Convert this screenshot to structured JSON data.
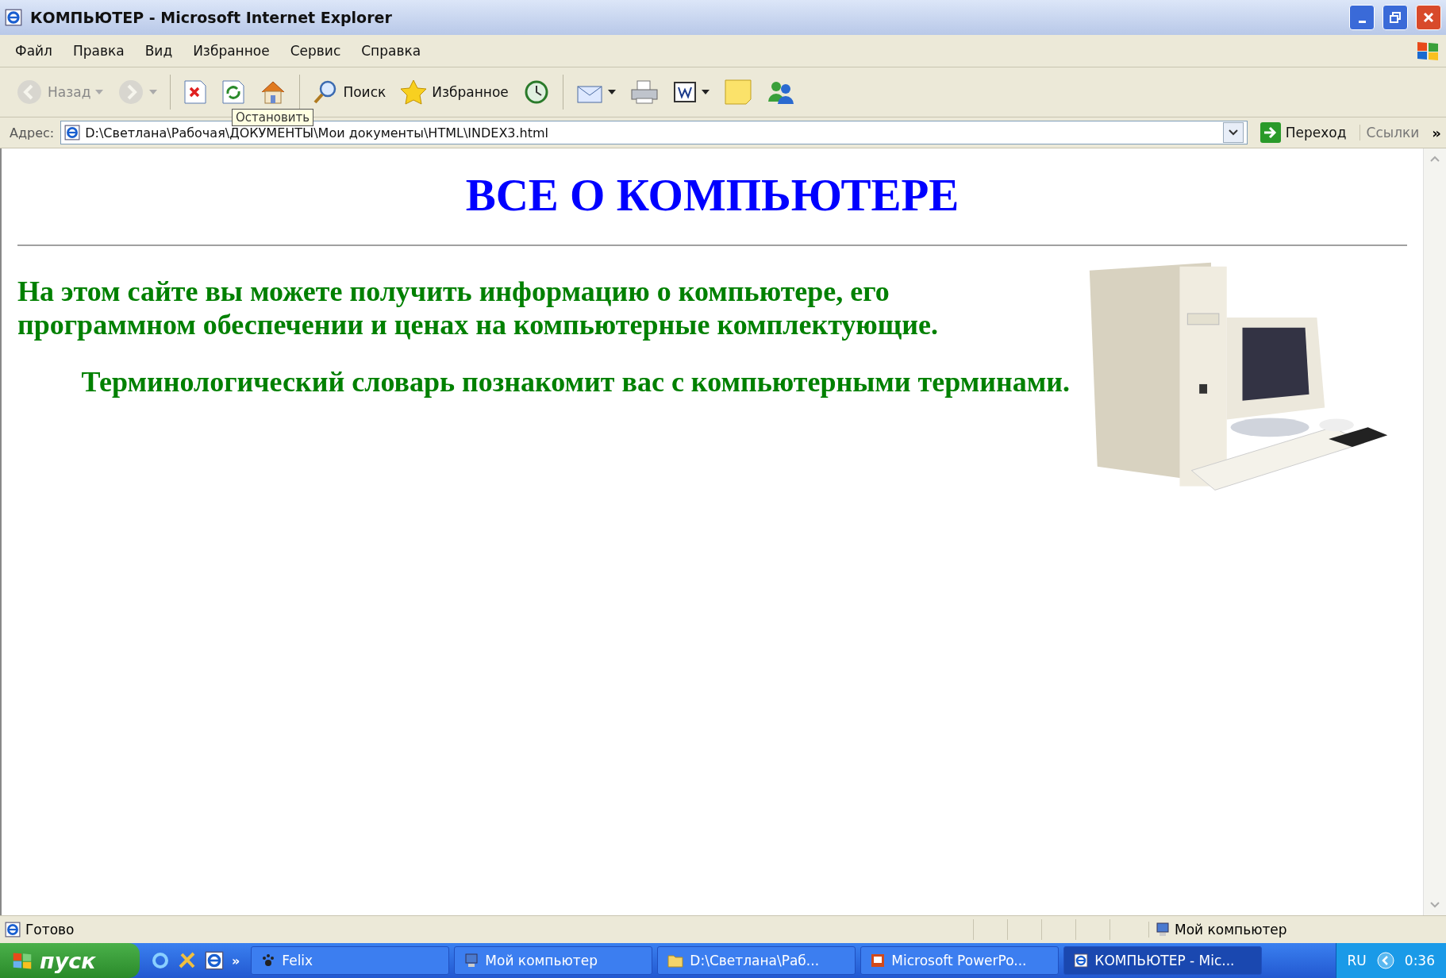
{
  "window": {
    "title": "КОМПЬЮТЕР - Microsoft Internet Explorer"
  },
  "menu": [
    "Файл",
    "Правка",
    "Вид",
    "Избранное",
    "Сервис",
    "Справка"
  ],
  "toolbar": [
    {
      "kind": "back",
      "label": "Назад",
      "disabled": true,
      "dropdown": true
    },
    {
      "kind": "forward",
      "disabled": true,
      "dropdown": true
    },
    {
      "kind": "stop",
      "disabled": false,
      "dropdown": false
    },
    {
      "kind": "refresh",
      "disabled": false,
      "dropdown": false
    },
    {
      "kind": "home",
      "disabled": false,
      "dropdown": false
    },
    {
      "kind": "search",
      "label": "Поиск",
      "disabled": false,
      "dropdown": false
    },
    {
      "kind": "favorites",
      "label": "Избранное",
      "disabled": false,
      "dropdown": false
    },
    {
      "kind": "history",
      "disabled": false,
      "dropdown": false
    },
    {
      "kind": "mail",
      "disabled": false,
      "dropdown": true
    },
    {
      "kind": "print",
      "disabled": false,
      "dropdown": false
    },
    {
      "kind": "edit",
      "disabled": false,
      "dropdown": true
    },
    {
      "kind": "note",
      "disabled": false,
      "dropdown": false
    },
    {
      "kind": "messenger",
      "disabled": false,
      "dropdown": false
    }
  ],
  "tooltip": "Остановить",
  "address": {
    "label": "Адрес:",
    "value": "D:\\Светлана\\Рабочая\\ДОКУМЕНТЫ\\Мои документы\\HTML\\INDEX3.html",
    "go": "Переход",
    "links": "Ссылки",
    "more": "»"
  },
  "page": {
    "heading": "ВСЕ О КОМПЬЮТЕРЕ",
    "paragraphs": [
      "На этом сайте вы можете получить информацию о компьютере, его программном обеспечении и ценах на компьютерные комплектующие.",
      "Терминологический словарь познакомит вас с компьютерными терминами."
    ]
  },
  "status_bar": {
    "text": "Готово",
    "zone": "Мой компьютер"
  },
  "taskbar": {
    "start": "пуск",
    "more": "»",
    "tasks": [
      {
        "label": "Felix",
        "selected": false
      },
      {
        "label": "Мой компьютер",
        "selected": false
      },
      {
        "label": "D:\\Светлана\\Раб...",
        "selected": false
      },
      {
        "label": "Microsoft PowerPo...",
        "selected": false
      },
      {
        "label": "КОМПЬЮТЕР - Mic...",
        "selected": true
      }
    ],
    "lang": "RU",
    "clock": "0:36"
  }
}
